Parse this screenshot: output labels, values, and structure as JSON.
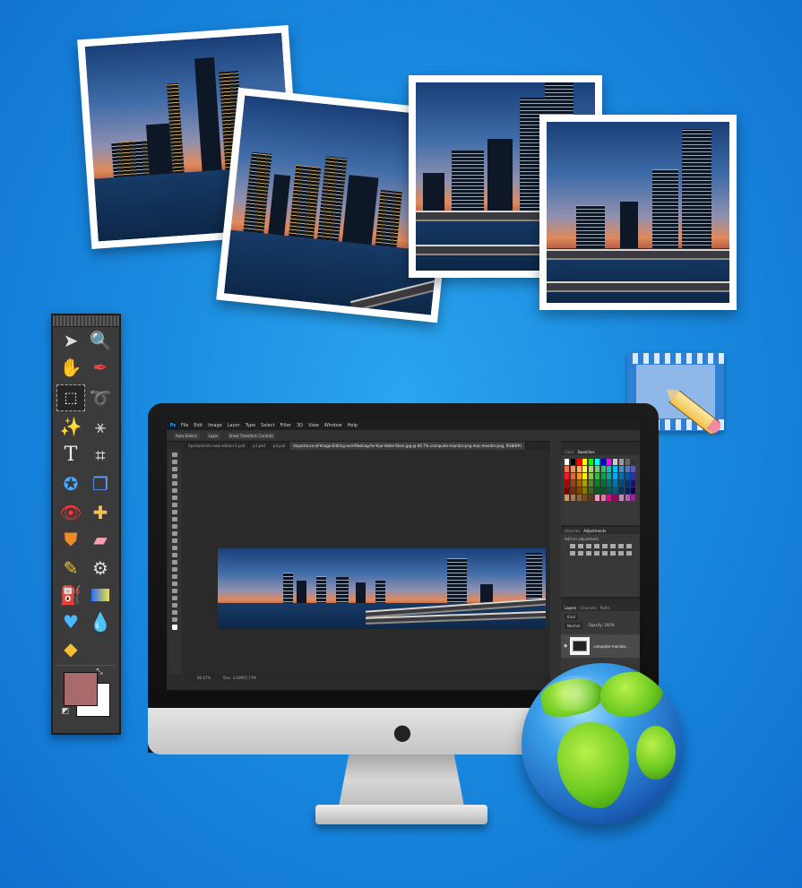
{
  "photos": [
    {
      "name": "cityscape-photo-1"
    },
    {
      "name": "cityscape-photo-2"
    },
    {
      "name": "cityscape-photo-3"
    },
    {
      "name": "cityscape-photo-4"
    }
  ],
  "tool_palette": {
    "tools": [
      "move-tool",
      "zoom-tool",
      "hand-tool",
      "eyedropper-tool",
      "marquee-tool",
      "lasso-tool",
      "magic-wand-tool",
      "quick-selection-tool",
      "type-tool",
      "crop-tool",
      "red-eye-tool",
      "clone-stamp-tool",
      "red-eye-removal-tool",
      "healing-brush-tool",
      "stamp-tool",
      "eraser-tool",
      "pencil-tool",
      "color-replacement-tool",
      "paint-bucket-tool",
      "gradient-tool",
      "smudge-tool",
      "blur-tool",
      "sponge-tool"
    ],
    "foreground_color": "#a86a6a",
    "background_color": "#ffffff"
  },
  "photoshop": {
    "logo": "Ps",
    "menu": [
      "File",
      "Edit",
      "Image",
      "Layer",
      "Type",
      "Select",
      "Filter",
      "3D",
      "View",
      "Window",
      "Help"
    ],
    "options": [
      "Auto-Select:",
      "Layer",
      "Show Transform Controls"
    ],
    "tabs": [
      {
        "label": "Apartaments-new-edition-1.psd",
        "active": false
      },
      {
        "label": "p1.psd",
        "active": false
      },
      {
        "label": "p3.psd",
        "active": false
      },
      {
        "label": "Importance-of-Image-Editing-and-Masking-for-Your-Hotel-Store.jpg @ 66.7% (computer-monitor-png-mac-monitor-png, RGB/8#)",
        "active": true
      }
    ],
    "status": {
      "zoom": "66.67%",
      "doc": "Doc: 3.60M/5.77M"
    },
    "panels": {
      "swatches": [
        "Color",
        "Swatches"
      ],
      "adjustments": [
        "Libraries",
        "Adjustments"
      ],
      "adjustments_hint": "Add an adjustment",
      "layers": [
        "Layers",
        "Channels",
        "Paths"
      ],
      "layers_kind": "Kind",
      "blend_mode": "Normal",
      "opacity": "Opacity: 100%",
      "layer_name": "computer-monitor..."
    }
  },
  "colors": {
    "background": "#1a8be0",
    "ps_accent": "#31a8ff"
  }
}
